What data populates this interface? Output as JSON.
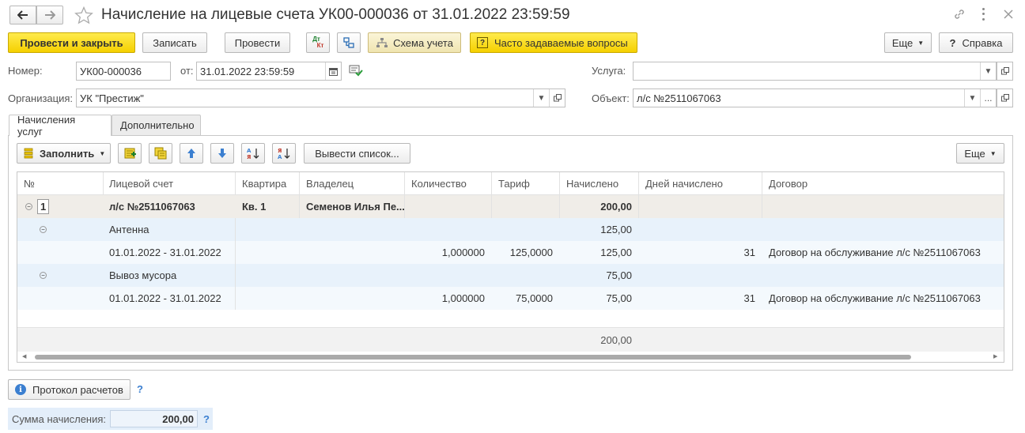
{
  "window": {
    "title": "Начисление на лицевые счета УК00-000036 от 31.01.2022 23:59:59"
  },
  "toolbar": {
    "post_close": "Провести и закрыть",
    "save": "Записать",
    "post": "Провести",
    "dt_kt_top": "Дт",
    "dt_kt_bottom": "Кт",
    "accounting_scheme": "Схема учета",
    "faq": "Часто задаваемые вопросы",
    "more": "Еще",
    "help": "Справка"
  },
  "form": {
    "number_label": "Номер:",
    "number_value": "УК00-000036",
    "from_label": "от:",
    "date_value": "31.01.2022 23:59:59",
    "org_label": "Организация:",
    "org_value": "УК \"Престиж\"",
    "service_label": "Услуга:",
    "service_value": "",
    "object_label": "Объект:",
    "object_value": "л/с №2511067063"
  },
  "tabs": [
    {
      "label": "Начисления услуг",
      "active": true
    },
    {
      "label": "Дополнительно",
      "active": false
    }
  ],
  "table_toolbar": {
    "fill": "Заполнить",
    "output_list": "Вывести список...",
    "more": "Еще"
  },
  "table": {
    "columns": [
      "№",
      "Лицевой счет",
      "Квартира",
      "Владелец",
      "Количество",
      "Тариф",
      "Начислено",
      "Дней начислено",
      "Договор"
    ],
    "group": {
      "num": "1",
      "account": "л/с №2511067063",
      "apartment": "Кв. 1",
      "owner": "Семенов Илья Пе...",
      "accrued": "200,00"
    },
    "rows": [
      {
        "type": "service",
        "name": "Антенна",
        "accrued": "125,00"
      },
      {
        "type": "period",
        "period": "01.01.2022 - 31.01.2022",
        "qty": "1,000000",
        "tariff": "125,0000",
        "accrued": "125,00",
        "days": "31",
        "contract": "Договор на обслуживание л/с №2511067063"
      },
      {
        "type": "service",
        "name": "Вывоз мусора",
        "accrued": "75,00"
      },
      {
        "type": "period",
        "period": "01.01.2022 - 31.01.2022",
        "qty": "1,000000",
        "tariff": "75,0000",
        "accrued": "75,00",
        "days": "31",
        "contract": "Договор на обслуживание л/с №2511067063"
      }
    ],
    "total": "200,00"
  },
  "footer": {
    "protocol": "Протокол расчетов",
    "sum_label": "Сумма начисления:",
    "sum_value": "200,00",
    "help_q": "?"
  },
  "colors": {
    "accent_yellow": "#f5d000",
    "group_row": "#f0ede8",
    "row_blue": "#e8f2fb",
    "row_light": "#f4f9fd",
    "icon_blue": "#3b7fd0"
  }
}
